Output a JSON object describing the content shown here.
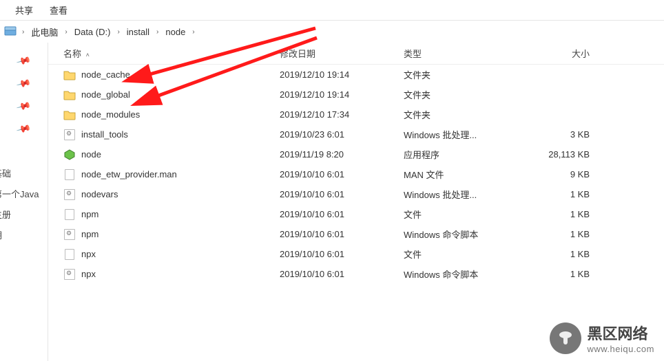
{
  "topbar": {
    "share": "共享",
    "view": "查看"
  },
  "breadcrumb": {
    "root": "此电脑",
    "drive": "Data (D:)",
    "p1": "install",
    "p2": "node"
  },
  "columns": {
    "name": "名称",
    "date": "修改日期",
    "type": "类型",
    "size": "大小"
  },
  "sidebar_labels": {
    "base": "基础",
    "java": "第一个Java",
    "reg": "主册",
    "date": "期"
  },
  "rows": [
    {
      "name": "node_cache",
      "date": "2019/12/10 19:14",
      "type": "文件夹",
      "size": "",
      "kind": "folder"
    },
    {
      "name": "node_global",
      "date": "2019/12/10 19:14",
      "type": "文件夹",
      "size": "",
      "kind": "folder"
    },
    {
      "name": "node_modules",
      "date": "2019/12/10 17:34",
      "type": "文件夹",
      "size": "",
      "kind": "folder"
    },
    {
      "name": "install_tools",
      "date": "2019/10/23 6:01",
      "type": "Windows 批处理...",
      "size": "3 KB",
      "kind": "gear"
    },
    {
      "name": "node",
      "date": "2019/11/19 8:20",
      "type": "应用程序",
      "size": "28,113 KB",
      "kind": "nodeexe"
    },
    {
      "name": "node_etw_provider.man",
      "date": "2019/10/10 6:01",
      "type": "MAN 文件",
      "size": "9 KB",
      "kind": "blank"
    },
    {
      "name": "nodevars",
      "date": "2019/10/10 6:01",
      "type": "Windows 批处理...",
      "size": "1 KB",
      "kind": "gear"
    },
    {
      "name": "npm",
      "date": "2019/10/10 6:01",
      "type": "文件",
      "size": "1 KB",
      "kind": "blank"
    },
    {
      "name": "npm",
      "date": "2019/10/10 6:01",
      "type": "Windows 命令脚本",
      "size": "1 KB",
      "kind": "gear"
    },
    {
      "name": "npx",
      "date": "2019/10/10 6:01",
      "type": "文件",
      "size": "1 KB",
      "kind": "blank"
    },
    {
      "name": "npx",
      "date": "2019/10/10 6:01",
      "type": "Windows 命令脚本",
      "size": "1 KB",
      "kind": "gear"
    }
  ],
  "watermark": {
    "brand": "黑区网络",
    "url": "www.heiqu.com"
  }
}
